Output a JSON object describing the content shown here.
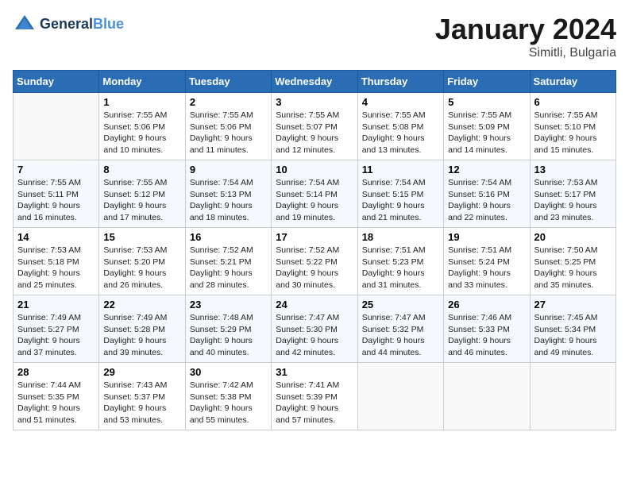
{
  "logo": {
    "line1": "General",
    "line2": "Blue"
  },
  "title": "January 2024",
  "subtitle": "Simitli, Bulgaria",
  "days_of_week": [
    "Sunday",
    "Monday",
    "Tuesday",
    "Wednesday",
    "Thursday",
    "Friday",
    "Saturday"
  ],
  "weeks": [
    [
      {
        "day": "",
        "info": ""
      },
      {
        "day": "1",
        "info": "Sunrise: 7:55 AM\nSunset: 5:06 PM\nDaylight: 9 hours\nand 10 minutes."
      },
      {
        "day": "2",
        "info": "Sunrise: 7:55 AM\nSunset: 5:06 PM\nDaylight: 9 hours\nand 11 minutes."
      },
      {
        "day": "3",
        "info": "Sunrise: 7:55 AM\nSunset: 5:07 PM\nDaylight: 9 hours\nand 12 minutes."
      },
      {
        "day": "4",
        "info": "Sunrise: 7:55 AM\nSunset: 5:08 PM\nDaylight: 9 hours\nand 13 minutes."
      },
      {
        "day": "5",
        "info": "Sunrise: 7:55 AM\nSunset: 5:09 PM\nDaylight: 9 hours\nand 14 minutes."
      },
      {
        "day": "6",
        "info": "Sunrise: 7:55 AM\nSunset: 5:10 PM\nDaylight: 9 hours\nand 15 minutes."
      }
    ],
    [
      {
        "day": "7",
        "info": "Sunrise: 7:55 AM\nSunset: 5:11 PM\nDaylight: 9 hours\nand 16 minutes."
      },
      {
        "day": "8",
        "info": "Sunrise: 7:55 AM\nSunset: 5:12 PM\nDaylight: 9 hours\nand 17 minutes."
      },
      {
        "day": "9",
        "info": "Sunrise: 7:54 AM\nSunset: 5:13 PM\nDaylight: 9 hours\nand 18 minutes."
      },
      {
        "day": "10",
        "info": "Sunrise: 7:54 AM\nSunset: 5:14 PM\nDaylight: 9 hours\nand 19 minutes."
      },
      {
        "day": "11",
        "info": "Sunrise: 7:54 AM\nSunset: 5:15 PM\nDaylight: 9 hours\nand 21 minutes."
      },
      {
        "day": "12",
        "info": "Sunrise: 7:54 AM\nSunset: 5:16 PM\nDaylight: 9 hours\nand 22 minutes."
      },
      {
        "day": "13",
        "info": "Sunrise: 7:53 AM\nSunset: 5:17 PM\nDaylight: 9 hours\nand 23 minutes."
      }
    ],
    [
      {
        "day": "14",
        "info": "Sunrise: 7:53 AM\nSunset: 5:18 PM\nDaylight: 9 hours\nand 25 minutes."
      },
      {
        "day": "15",
        "info": "Sunrise: 7:53 AM\nSunset: 5:20 PM\nDaylight: 9 hours\nand 26 minutes."
      },
      {
        "day": "16",
        "info": "Sunrise: 7:52 AM\nSunset: 5:21 PM\nDaylight: 9 hours\nand 28 minutes."
      },
      {
        "day": "17",
        "info": "Sunrise: 7:52 AM\nSunset: 5:22 PM\nDaylight: 9 hours\nand 30 minutes."
      },
      {
        "day": "18",
        "info": "Sunrise: 7:51 AM\nSunset: 5:23 PM\nDaylight: 9 hours\nand 31 minutes."
      },
      {
        "day": "19",
        "info": "Sunrise: 7:51 AM\nSunset: 5:24 PM\nDaylight: 9 hours\nand 33 minutes."
      },
      {
        "day": "20",
        "info": "Sunrise: 7:50 AM\nSunset: 5:25 PM\nDaylight: 9 hours\nand 35 minutes."
      }
    ],
    [
      {
        "day": "21",
        "info": "Sunrise: 7:49 AM\nSunset: 5:27 PM\nDaylight: 9 hours\nand 37 minutes."
      },
      {
        "day": "22",
        "info": "Sunrise: 7:49 AM\nSunset: 5:28 PM\nDaylight: 9 hours\nand 39 minutes."
      },
      {
        "day": "23",
        "info": "Sunrise: 7:48 AM\nSunset: 5:29 PM\nDaylight: 9 hours\nand 40 minutes."
      },
      {
        "day": "24",
        "info": "Sunrise: 7:47 AM\nSunset: 5:30 PM\nDaylight: 9 hours\nand 42 minutes."
      },
      {
        "day": "25",
        "info": "Sunrise: 7:47 AM\nSunset: 5:32 PM\nDaylight: 9 hours\nand 44 minutes."
      },
      {
        "day": "26",
        "info": "Sunrise: 7:46 AM\nSunset: 5:33 PM\nDaylight: 9 hours\nand 46 minutes."
      },
      {
        "day": "27",
        "info": "Sunrise: 7:45 AM\nSunset: 5:34 PM\nDaylight: 9 hours\nand 49 minutes."
      }
    ],
    [
      {
        "day": "28",
        "info": "Sunrise: 7:44 AM\nSunset: 5:35 PM\nDaylight: 9 hours\nand 51 minutes."
      },
      {
        "day": "29",
        "info": "Sunrise: 7:43 AM\nSunset: 5:37 PM\nDaylight: 9 hours\nand 53 minutes."
      },
      {
        "day": "30",
        "info": "Sunrise: 7:42 AM\nSunset: 5:38 PM\nDaylight: 9 hours\nand 55 minutes."
      },
      {
        "day": "31",
        "info": "Sunrise: 7:41 AM\nSunset: 5:39 PM\nDaylight: 9 hours\nand 57 minutes."
      },
      {
        "day": "",
        "info": ""
      },
      {
        "day": "",
        "info": ""
      },
      {
        "day": "",
        "info": ""
      }
    ]
  ]
}
